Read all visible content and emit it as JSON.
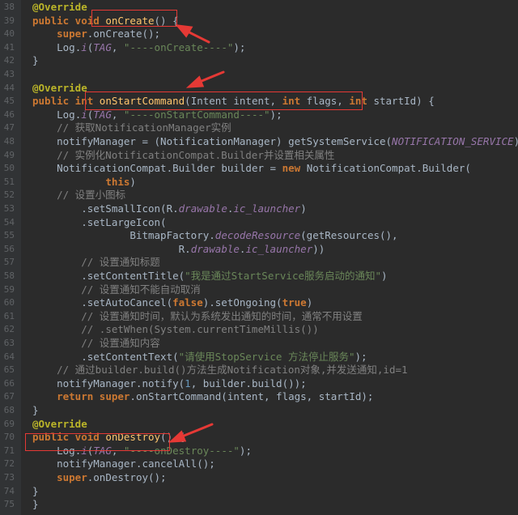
{
  "lines": [
    {
      "n": "38",
      "segs": [
        [
          "anno",
          "@Override"
        ]
      ]
    },
    {
      "n": "39",
      "segs": [
        [
          "kw",
          "public void "
        ],
        [
          "fn",
          "onCreate"
        ],
        [
          "plain",
          "() {"
        ]
      ]
    },
    {
      "n": "40",
      "segs": [
        [
          "plain",
          "    "
        ],
        [
          "kw",
          "super"
        ],
        [
          "plain",
          ".onCreate();"
        ]
      ]
    },
    {
      "n": "41",
      "segs": [
        [
          "plain",
          "    "
        ],
        [
          "cls",
          "Log"
        ],
        [
          "plain",
          "."
        ],
        [
          "field",
          "i"
        ],
        [
          "plain",
          "("
        ],
        [
          "field",
          "TAG"
        ],
        [
          "plain",
          ", "
        ],
        [
          "str",
          "\"----onCreate----\""
        ],
        [
          "plain",
          ");"
        ]
      ]
    },
    {
      "n": "42",
      "segs": [
        [
          "plain",
          "}"
        ]
      ]
    },
    {
      "n": "43",
      "segs": [
        [
          "plain",
          ""
        ]
      ]
    },
    {
      "n": "44",
      "segs": [
        [
          "anno",
          "@Override"
        ]
      ]
    },
    {
      "n": "45",
      "segs": [
        [
          "kw",
          "public int "
        ],
        [
          "fn",
          "onStartCommand"
        ],
        [
          "plain",
          "("
        ],
        [
          "cls",
          "Intent"
        ],
        [
          "plain",
          " intent, "
        ],
        [
          "kw",
          "int"
        ],
        [
          "plain",
          " flags, "
        ],
        [
          "kw",
          "int"
        ],
        [
          "plain",
          " startId) {"
        ]
      ]
    },
    {
      "n": "46",
      "segs": [
        [
          "plain",
          "    "
        ],
        [
          "cls",
          "Log"
        ],
        [
          "plain",
          "."
        ],
        [
          "field",
          "i"
        ],
        [
          "plain",
          "("
        ],
        [
          "field",
          "TAG"
        ],
        [
          "plain",
          ", "
        ],
        [
          "str",
          "\"----onStartCommand----\""
        ],
        [
          "plain",
          ");"
        ]
      ]
    },
    {
      "n": "47",
      "segs": [
        [
          "plain",
          "    "
        ],
        [
          "cmt",
          "// 获取NotificationManager实例"
        ]
      ]
    },
    {
      "n": "48",
      "segs": [
        [
          "plain",
          "    notifyManager = ("
        ],
        [
          "cls",
          "NotificationManager"
        ],
        [
          "plain",
          ") getSystemService("
        ],
        [
          "field",
          "NOTIFICATION_SERVICE"
        ],
        [
          "plain",
          ");"
        ]
      ]
    },
    {
      "n": "49",
      "segs": [
        [
          "plain",
          "    "
        ],
        [
          "cmt",
          "// 实例化NotificationCompat.Builder并设置相关属性"
        ]
      ]
    },
    {
      "n": "50",
      "segs": [
        [
          "plain",
          "    "
        ],
        [
          "cls",
          "NotificationCompat"
        ],
        [
          "plain",
          "."
        ],
        [
          "cls",
          "Builder"
        ],
        [
          "plain",
          " builder = "
        ],
        [
          "kw",
          "new "
        ],
        [
          "cls",
          "NotificationCompat"
        ],
        [
          "plain",
          "."
        ],
        [
          "cls",
          "Builder"
        ],
        [
          "plain",
          "("
        ]
      ]
    },
    {
      "n": "51",
      "segs": [
        [
          "plain",
          "            "
        ],
        [
          "kw",
          "this"
        ],
        [
          "plain",
          ")"
        ]
      ]
    },
    {
      "n": "52",
      "segs": [
        [
          "plain",
          "    "
        ],
        [
          "cmt",
          "// 设置小图标"
        ]
      ]
    },
    {
      "n": "53",
      "segs": [
        [
          "plain",
          "        .setSmallIcon("
        ],
        [
          "cls",
          "R"
        ],
        [
          "plain",
          "."
        ],
        [
          "field",
          "drawable"
        ],
        [
          "plain",
          "."
        ],
        [
          "field",
          "ic_launcher"
        ],
        [
          "plain",
          ")"
        ]
      ]
    },
    {
      "n": "54",
      "segs": [
        [
          "plain",
          "        .setLargeIcon("
        ]
      ]
    },
    {
      "n": "55",
      "segs": [
        [
          "plain",
          "                "
        ],
        [
          "cls",
          "BitmapFactory"
        ],
        [
          "plain",
          "."
        ],
        [
          "field",
          "decodeResource"
        ],
        [
          "plain",
          "(getResources(),"
        ]
      ]
    },
    {
      "n": "56",
      "segs": [
        [
          "plain",
          "                        "
        ],
        [
          "cls",
          "R"
        ],
        [
          "plain",
          "."
        ],
        [
          "field",
          "drawable"
        ],
        [
          "plain",
          "."
        ],
        [
          "field",
          "ic_launcher"
        ],
        [
          "plain",
          "))"
        ]
      ]
    },
    {
      "n": "57",
      "segs": [
        [
          "plain",
          "        "
        ],
        [
          "cmt",
          "// 设置通知标题"
        ]
      ]
    },
    {
      "n": "58",
      "segs": [
        [
          "plain",
          "        .setContentTitle("
        ],
        [
          "str",
          "\"我是通过StartService服务启动的通知\""
        ],
        [
          "plain",
          ")"
        ]
      ]
    },
    {
      "n": "59",
      "segs": [
        [
          "plain",
          "        "
        ],
        [
          "cmt",
          "// 设置通知不能自动取消"
        ]
      ]
    },
    {
      "n": "60",
      "segs": [
        [
          "plain",
          "        .setAutoCancel("
        ],
        [
          "kw",
          "false"
        ],
        [
          "plain",
          ").setOngoing("
        ],
        [
          "kw",
          "true"
        ],
        [
          "plain",
          ")"
        ]
      ]
    },
    {
      "n": "61",
      "segs": [
        [
          "plain",
          "        "
        ],
        [
          "cmt",
          "// 设置通知时间，默认为系统发出通知的时间，通常不用设置"
        ]
      ]
    },
    {
      "n": "62",
      "segs": [
        [
          "plain",
          "        "
        ],
        [
          "cmt",
          "// .setWhen(System.currentTimeMillis())"
        ]
      ]
    },
    {
      "n": "63",
      "segs": [
        [
          "plain",
          "        "
        ],
        [
          "cmt",
          "// 设置通知内容"
        ]
      ]
    },
    {
      "n": "64",
      "segs": [
        [
          "plain",
          "        .setContentText("
        ],
        [
          "str",
          "\"请使用StopService 方法停止服务\""
        ],
        [
          "plain",
          ");"
        ]
      ]
    },
    {
      "n": "65",
      "segs": [
        [
          "plain",
          "    "
        ],
        [
          "cmt",
          "// 通过builder.build()方法生成Notification对象,并发送通知,id=1"
        ]
      ]
    },
    {
      "n": "66",
      "segs": [
        [
          "plain",
          "    notifyManager.notify("
        ],
        [
          "num",
          "1"
        ],
        [
          "plain",
          ", builder.build());"
        ]
      ]
    },
    {
      "n": "67",
      "segs": [
        [
          "plain",
          "    "
        ],
        [
          "kw",
          "return super"
        ],
        [
          "plain",
          ".onStartCommand(intent, flags, startId);"
        ]
      ]
    },
    {
      "n": "68",
      "segs": [
        [
          "plain",
          "}"
        ]
      ]
    },
    {
      "n": "69",
      "segs": [
        [
          "anno",
          "@Override"
        ]
      ]
    },
    {
      "n": "70",
      "segs": [
        [
          "kw",
          "public void "
        ],
        [
          "fn",
          "onDestroy"
        ],
        [
          "plain",
          "() {"
        ]
      ]
    },
    {
      "n": "71",
      "segs": [
        [
          "plain",
          "    "
        ],
        [
          "cls",
          "Log"
        ],
        [
          "plain",
          "."
        ],
        [
          "field",
          "i"
        ],
        [
          "plain",
          "("
        ],
        [
          "field",
          "TAG"
        ],
        [
          "plain",
          ", "
        ],
        [
          "str",
          "\"----onDestroy----\""
        ],
        [
          "plain",
          ");"
        ]
      ]
    },
    {
      "n": "72",
      "segs": [
        [
          "plain",
          "    notifyManager.cancelAll();"
        ]
      ]
    },
    {
      "n": "73",
      "segs": [
        [
          "plain",
          "    "
        ],
        [
          "kw",
          "super"
        ],
        [
          "plain",
          ".onDestroy();"
        ]
      ]
    },
    {
      "n": "74",
      "segs": [
        [
          "plain",
          "}"
        ]
      ]
    },
    {
      "n": "75",
      "segs": [
        [
          "plain",
          "}"
        ]
      ]
    }
  ],
  "colors": {
    "background": "#2b2b2b",
    "gutter": "#313335",
    "keyword": "#cc7832",
    "annotation": "#bbb529",
    "method": "#ffc66d",
    "string": "#6a8759",
    "comment": "#808080",
    "field": "#9876aa",
    "highlight": "#e53935"
  }
}
